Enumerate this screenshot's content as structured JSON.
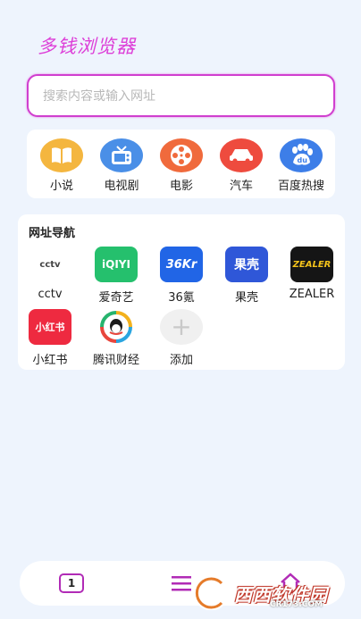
{
  "app": {
    "title": "多钱浏览器"
  },
  "search": {
    "placeholder": "搜索内容或输入网址"
  },
  "quick_links": [
    {
      "label": "小说",
      "icon": "book-icon",
      "color": "#f4b63f"
    },
    {
      "label": "电视剧",
      "icon": "tv-icon",
      "color": "#4a8fe7"
    },
    {
      "label": "电影",
      "icon": "film-reel-icon",
      "color": "#f06a3c"
    },
    {
      "label": "汽车",
      "icon": "car-icon",
      "color": "#ee4b3e"
    },
    {
      "label": "百度热搜",
      "icon": "baidu-paw-icon",
      "color": "#3d7ee8"
    }
  ],
  "site_nav": {
    "title": "网址导航",
    "sites": [
      {
        "label": "cctv",
        "logo_text": "cctv"
      },
      {
        "label": "爱奇艺",
        "logo_text": "iQIYI"
      },
      {
        "label": "36氪",
        "logo_text": "36Kr"
      },
      {
        "label": "果壳",
        "logo_text": "果壳"
      },
      {
        "label": "ZEALER",
        "logo_text": "ZEALER"
      },
      {
        "label": "小红书",
        "logo_text": "小红书"
      },
      {
        "label": "腾讯财经",
        "logo_text": ""
      },
      {
        "label": "添加",
        "logo_text": "+"
      }
    ]
  },
  "bottom_bar": {
    "tab_count": "1"
  },
  "watermark": {
    "text": "西西软件园",
    "sub": "CR173.COM"
  }
}
